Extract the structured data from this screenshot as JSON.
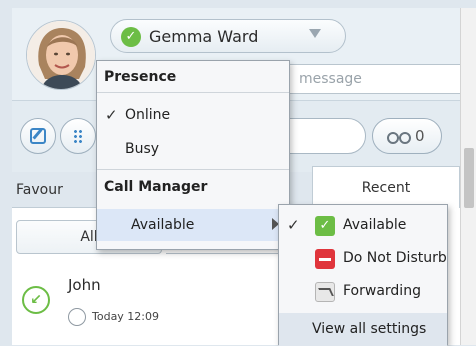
{
  "user": {
    "name": "Gemma Ward",
    "presence": "available"
  },
  "status_message": {
    "placeholder": "message"
  },
  "voicemail": {
    "count": "0"
  },
  "tabs": {
    "favourites": "Favour",
    "recent": "Recent"
  },
  "filter": {
    "all": "All"
  },
  "recent_calls": [
    {
      "name": "John",
      "time": "Today 12:09"
    }
  ],
  "presence_menu": {
    "presence_header": "Presence",
    "online": "Online",
    "busy": "Busy",
    "call_manager_header": "Call Manager",
    "available": "Available"
  },
  "status_submenu": {
    "available": "Available",
    "do_not_disturb": "Do Not Disturb",
    "forwarding": "Forwarding",
    "view_all_settings": "View all settings"
  },
  "colors": {
    "available_green": "#6cbd45",
    "dnd_red": "#e0353c",
    "accent_blue": "#3c86c6",
    "menu_highlight": "#dce7f7"
  }
}
